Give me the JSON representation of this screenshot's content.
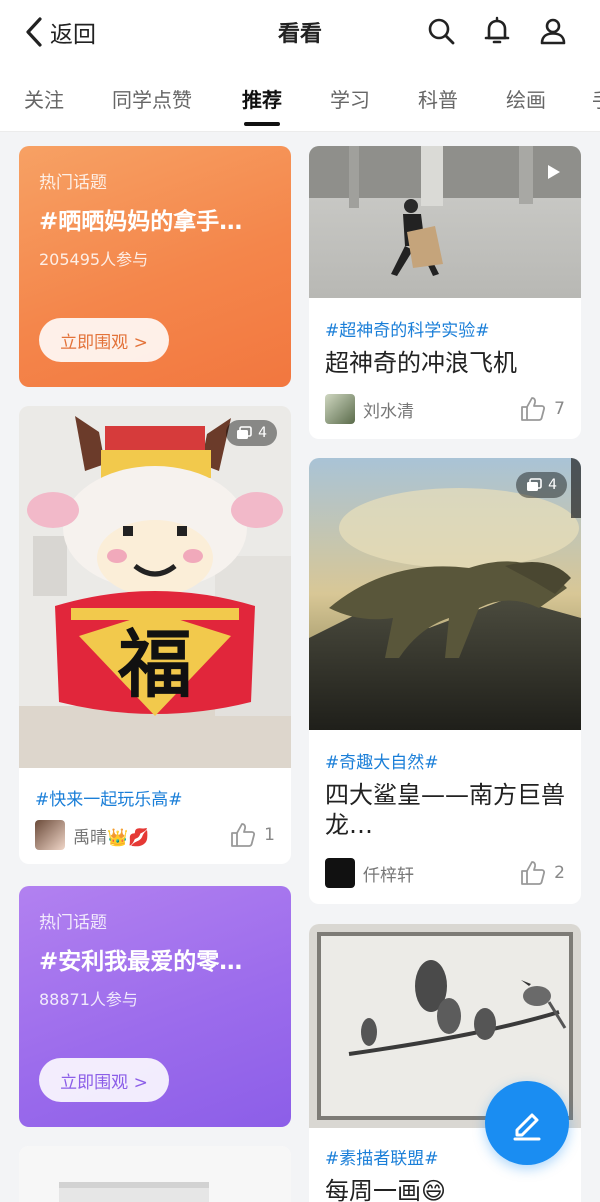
{
  "header": {
    "back_label": "返回",
    "title": "看看",
    "icons": [
      "search-icon",
      "bell-icon",
      "user-icon"
    ]
  },
  "tabs": [
    {
      "label": "关注",
      "active": false
    },
    {
      "label": "同学点赞",
      "active": false
    },
    {
      "label": "推荐",
      "active": true
    },
    {
      "label": "学习",
      "active": false
    },
    {
      "label": "科普",
      "active": false
    },
    {
      "label": "绘画",
      "active": false
    },
    {
      "label": "手",
      "active": false
    }
  ],
  "left_column": {
    "topic_1": {
      "kicker": "热门话题",
      "title": "#晒晒妈妈的拿手…",
      "participants": "205495人参与",
      "button_label": "立即围观 >"
    },
    "post_lego": {
      "image_count": "4",
      "hashtag": "#快来一起玩乐高#",
      "author": "禹晴👑💋",
      "likes": "1"
    },
    "topic_2": {
      "kicker": "热门话题",
      "title": "#安利我最爱的零…",
      "participants": "88871人参与",
      "button_label": "立即围观 >"
    }
  },
  "right_column": {
    "post_plane": {
      "hashtag": "#超神奇的科学实验#",
      "title": "超神奇的冲浪飞机",
      "author": "刘水清",
      "likes": "7"
    },
    "post_dino": {
      "image_count": "4",
      "hashtag": "#奇趣大自然#",
      "title": "四大鲨皇——南方巨兽龙…",
      "author": "仟梓轩",
      "likes": "2"
    },
    "post_sketch": {
      "hashtag": "#素描者联盟#",
      "title": "每周一画😄"
    }
  },
  "colors": {
    "accent_blue": "#1a8df2",
    "hashtag_blue": "#1b7fd8",
    "topic_orange": "#f4864b",
    "topic_purple": "#9c6cec"
  }
}
